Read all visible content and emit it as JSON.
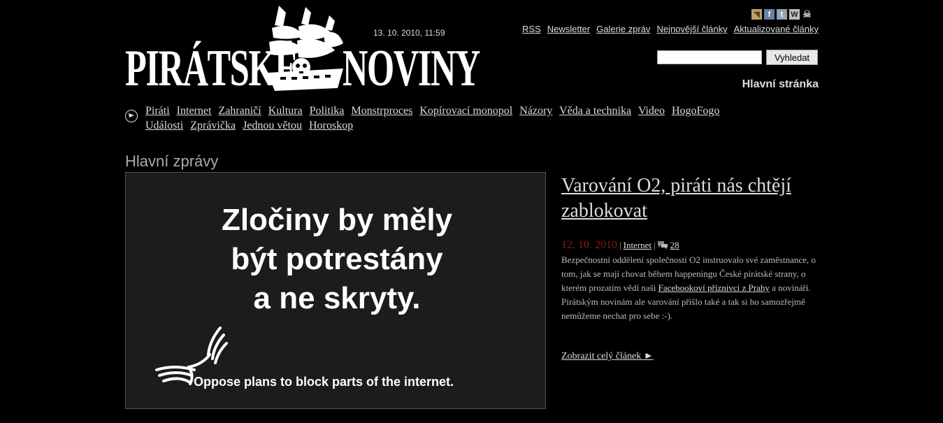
{
  "logo": {
    "left_word": "PIRÁTSKÉ",
    "right_word": "NOVINY"
  },
  "date": "13. 10. 2010, 11:59",
  "social": [
    {
      "icon": "rss-icon",
      "glyph": "◥"
    },
    {
      "icon": "facebook-icon",
      "glyph": "f"
    },
    {
      "icon": "twitter-icon",
      "glyph": "t"
    },
    {
      "icon": "wikipedia-icon",
      "glyph": "W"
    },
    {
      "icon": "piratebay-icon",
      "glyph": "☠"
    }
  ],
  "toplinks": [
    "RSS",
    "Newsletter",
    "Galerie zpráv",
    "Nejnovější články",
    "Aktualizované články"
  ],
  "search": {
    "value": "",
    "button": "Vyhledat"
  },
  "homepage_label": "Hlavní stránka",
  "nav": [
    "Piráti",
    "Internet",
    "Zahraničí",
    "Kultura",
    "Politika",
    "Monstrproces",
    "Kopírovací monopol",
    "Názory",
    "Věda a technika",
    "Video",
    "HogoFogo",
    "Události",
    "Zprávička",
    "Jednou větou",
    "Horoskop"
  ],
  "section_title": "Hlavní zprávy",
  "banner": {
    "line1": "Zločiny by měly",
    "line2": "být potrestány",
    "line3": "a ne skryty.",
    "bottom": "Oppose plans to block parts of the internet."
  },
  "article": {
    "title": "Varování O2, piráti nás chtějí zablokovat",
    "date": "12. 10. 2010",
    "category": "Internet",
    "comments": "28",
    "body_1": "Bezpečnostní oddělení společnosti O2 instruovalo své zaměstnance, o tom, jak se mají chovat během happeningu České pirátské strany, o kterém prozatím vědí naši ",
    "body_link": "Facebookoví příznivci z Prahy",
    "body_2": " a novináři. Pirátským novinám ale varování přišlo také a tak si ho samozřejmě nemůžeme nechat pro sebe :-).",
    "more": "Zobrazit celý článek ►"
  }
}
